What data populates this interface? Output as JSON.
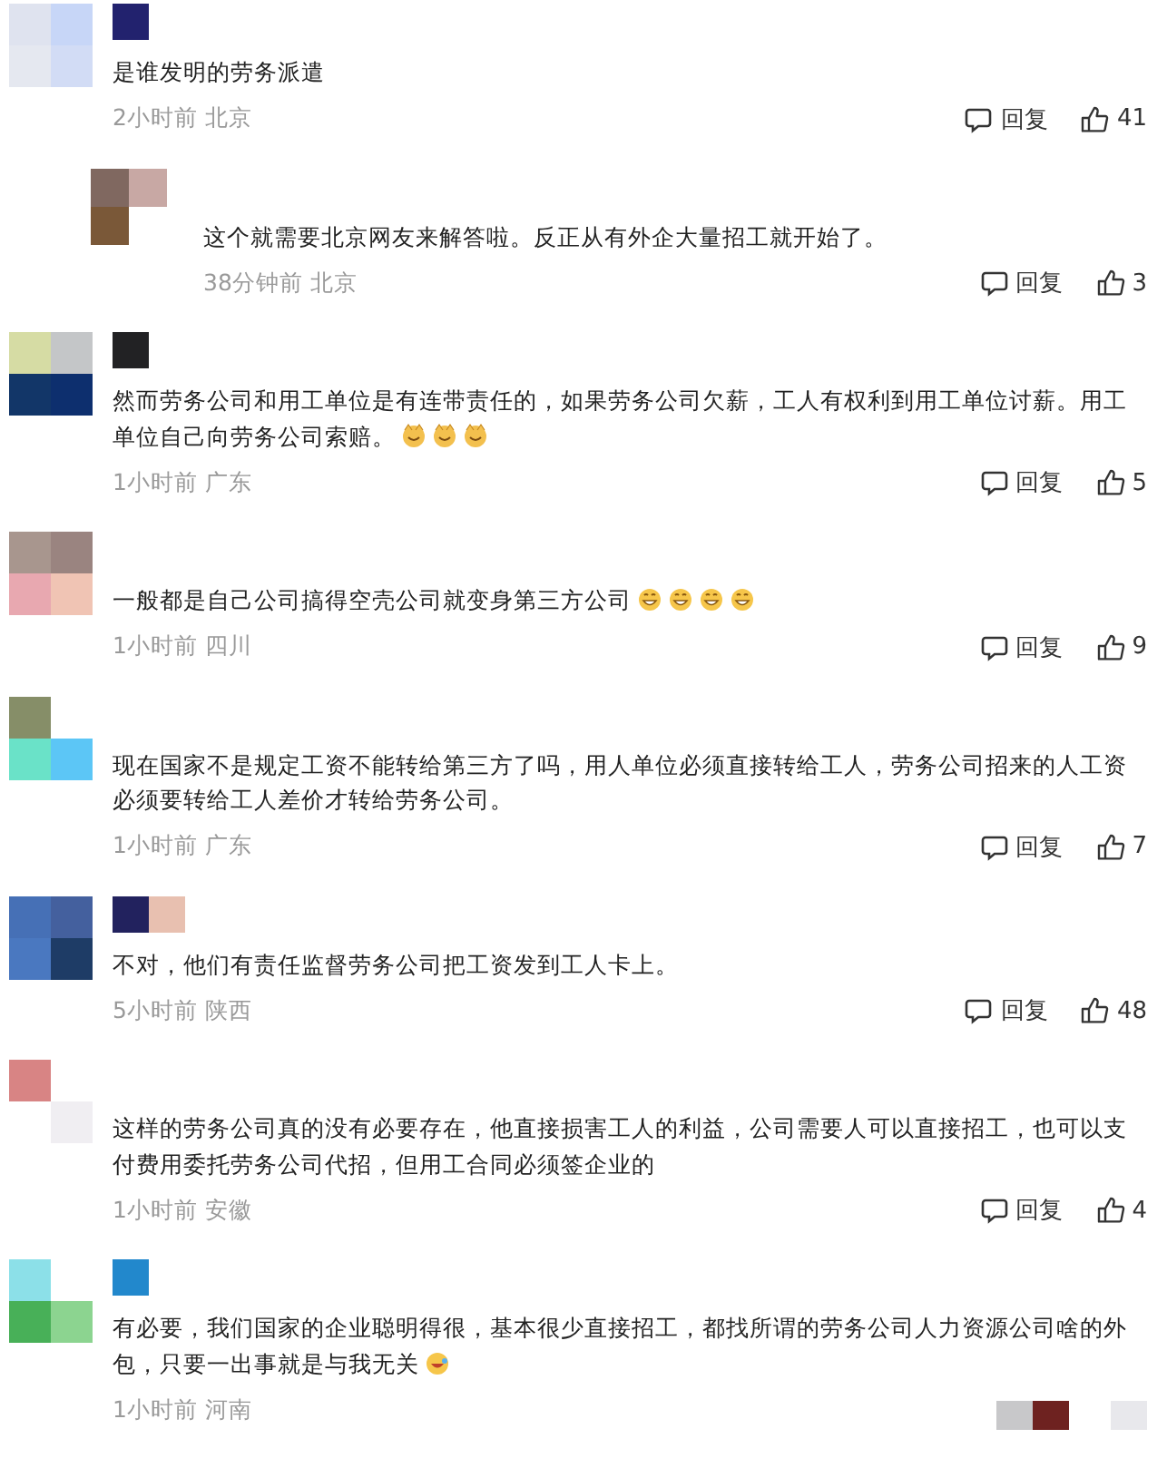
{
  "comments": [
    {
      "reply": false,
      "text": "是谁发明的劳务派遣",
      "time": "2小时前",
      "location": "北京",
      "reply_label": "回复",
      "likes": "41"
    },
    {
      "reply": true,
      "text": "这个就需要北京网友来解答啦。反正从有外企大量招工就开始了。",
      "time": "38分钟前",
      "location": "北京",
      "reply_label": "回复",
      "likes": "3"
    },
    {
      "reply": false,
      "text": "然而劳务公司和用工单位是有连带责任的，如果劳务公司欠薪，工人有权利到用工单位讨薪。用工单位自己向劳务公司索赔。",
      "emojis": [
        {
          "kind": "cat"
        },
        {
          "kind": "cat"
        },
        {
          "kind": "cat"
        }
      ],
      "time": "1小时前",
      "location": "广东",
      "reply_label": "回复",
      "likes": "5"
    },
    {
      "reply": false,
      "text": "一般都是自己公司搞得空壳公司就变身第三方公司",
      "emojis": [
        {
          "kind": "grin"
        },
        {
          "kind": "grin"
        },
        {
          "kind": "grin"
        },
        {
          "kind": "grin"
        }
      ],
      "time": "1小时前",
      "location": "四川",
      "reply_label": "回复",
      "likes": "9"
    },
    {
      "reply": false,
      "text": "现在国家不是规定工资不能转给第三方了吗，用人单位必须直接转给工人，劳务公司招来的人工资必须要转给工人差价才转给劳务公司。",
      "time": "1小时前",
      "location": "广东",
      "reply_label": "回复",
      "likes": "7"
    },
    {
      "reply": false,
      "text": "不对，他们有责任监督劳务公司把工资发到工人卡上。",
      "time": "5小时前",
      "location": "陕西",
      "reply_label": "回复",
      "likes": "48"
    },
    {
      "reply": false,
      "text": "这样的劳务公司真的没有必要存在，他直接损害工人的利益，公司需要人可以直接招工，也可以支付费用委托劳务公司代招，但用工合同必须签企业的",
      "time": "1小时前",
      "location": "安徽",
      "reply_label": "回复",
      "likes": "4"
    },
    {
      "reply": false,
      "text": "有必要，我们国家的企业聪明得很，基本很少直接招工，都找所谓的劳务公司人力资源公司啥的外包，只要一出事就是与我无关",
      "emojis": [
        {
          "kind": "laugh"
        }
      ],
      "time": "1小时前",
      "location": "河南"
    }
  ]
}
